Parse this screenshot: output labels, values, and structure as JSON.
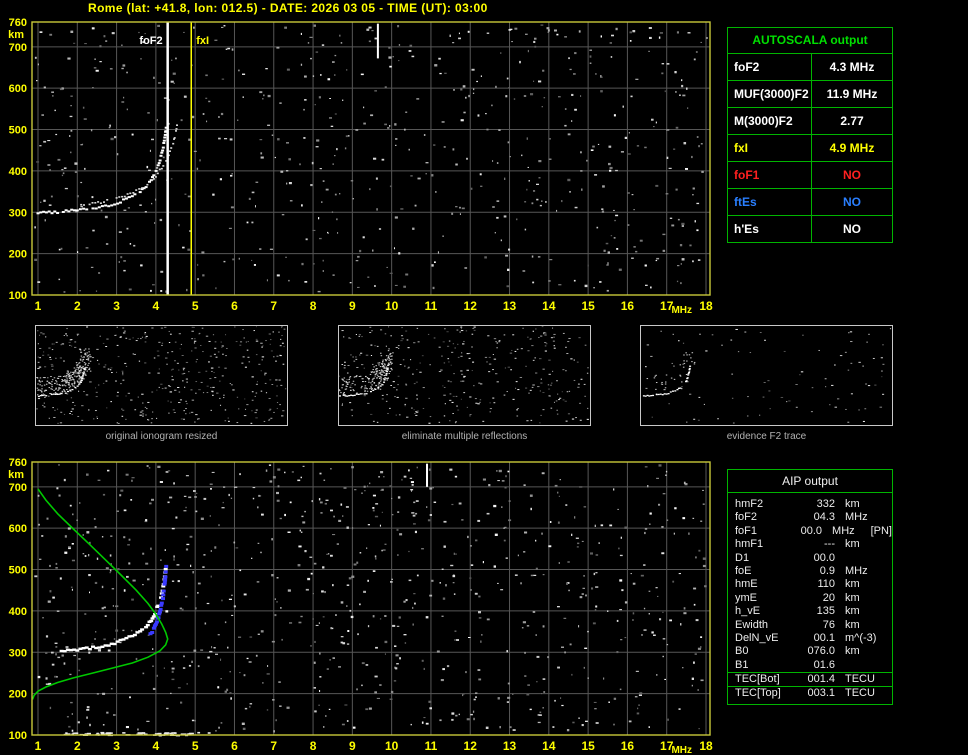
{
  "title": "Rome (lat: +41.8, lon: 012.5) - DATE: 2026 03 05 - TIME (UT): 03:00",
  "axes": {
    "f_min": 1,
    "f_max": 18,
    "km_min": 100,
    "km_max": 760,
    "x_ticks": [
      1,
      2,
      3,
      4,
      5,
      6,
      7,
      8,
      9,
      10,
      11,
      12,
      13,
      14,
      15,
      16,
      17,
      18
    ],
    "y_ticks": [
      760,
      700,
      600,
      500,
      400,
      300,
      200,
      100
    ],
    "x_unit": "MHz",
    "y_unit": "km"
  },
  "main_plot": {
    "noise_seed": 20260305,
    "noise_points": 640,
    "streaks": [
      {
        "f": 9.65,
        "km_top": 756,
        "km_bot": 672
      }
    ],
    "vlines": [
      {
        "label": "foF2",
        "f": 4.3,
        "color": "#ffffff",
        "label_side": "left",
        "width": 2.5
      },
      {
        "label": "fxI",
        "f": 4.9,
        "color": "#ffff00",
        "label_side": "right",
        "width": 1.5
      }
    ],
    "traces": [
      {
        "name": "F2-ordinary-trace",
        "color": "#ffffff",
        "dot": [
          3,
          2
        ],
        "points": [
          [
            1.0,
            298
          ],
          [
            1.5,
            301
          ],
          [
            2.0,
            305
          ],
          [
            2.4,
            310
          ],
          [
            2.8,
            317
          ],
          [
            3.1,
            326
          ],
          [
            3.4,
            338
          ],
          [
            3.6,
            350
          ],
          [
            3.75,
            362
          ],
          [
            3.88,
            377
          ],
          [
            3.98,
            394
          ],
          [
            4.06,
            413
          ],
          [
            4.13,
            434
          ],
          [
            4.19,
            458
          ],
          [
            4.24,
            485
          ],
          [
            4.27,
            512
          ]
        ]
      },
      {
        "name": "F2-extraordinary-trace",
        "color": "#d8d8d8",
        "dot": [
          2,
          1.6
        ],
        "points": [
          [
            2.1,
            316
          ],
          [
            2.6,
            324
          ],
          [
            3.0,
            334
          ],
          [
            3.35,
            345
          ],
          [
            3.65,
            358
          ],
          [
            3.85,
            372
          ],
          [
            4.0,
            388
          ],
          [
            4.15,
            408
          ],
          [
            4.3,
            432
          ],
          [
            4.42,
            460
          ],
          [
            4.5,
            490
          ],
          [
            4.55,
            515
          ]
        ]
      }
    ]
  },
  "thumbnails": [
    {
      "caption": "original ionogram resized",
      "seed": 11,
      "noise": 430,
      "cluster": 240,
      "show_trace": true
    },
    {
      "caption": "eliminate multiple reflections",
      "seed": 22,
      "noise": 360,
      "cluster": 200,
      "show_trace": true
    },
    {
      "caption": "evidence F2 trace",
      "seed": 33,
      "noise": 95,
      "cluster": 35,
      "show_trace": true
    }
  ],
  "bottom_plot": {
    "noise_seed": 7350,
    "noise_points": 820,
    "hclusters": [
      {
        "f1": 1.6,
        "f2": 5.4,
        "km": 104,
        "n": 55
      }
    ],
    "streaks": [
      {
        "f": 10.9,
        "km_top": 756,
        "km_bot": 700
      }
    ],
    "traces": [
      {
        "name": "scaled-F2-trace",
        "color": "#ffffff",
        "dot": [
          4,
          2.4
        ],
        "points": [
          [
            1.6,
            302
          ],
          [
            2.0,
            306
          ],
          [
            2.4,
            311
          ],
          [
            2.8,
            318
          ],
          [
            3.1,
            327
          ],
          [
            3.4,
            339
          ],
          [
            3.6,
            351
          ],
          [
            3.75,
            363
          ],
          [
            3.88,
            378
          ],
          [
            3.98,
            395
          ],
          [
            4.06,
            414
          ],
          [
            4.13,
            435
          ],
          [
            4.19,
            459
          ],
          [
            4.23,
            485
          ],
          [
            4.26,
            508
          ]
        ]
      },
      {
        "name": "fitted-trace",
        "color": "#3a3aff",
        "dot": [
          4,
          3
        ],
        "points": [
          [
            3.82,
            336
          ],
          [
            3.95,
            356
          ],
          [
            4.05,
            380
          ],
          [
            4.12,
            405
          ],
          [
            4.18,
            432
          ],
          [
            4.22,
            462
          ],
          [
            4.25,
            492
          ],
          [
            4.27,
            512
          ]
        ]
      }
    ],
    "lines": [
      {
        "name": "electron-density-profile",
        "color": "#00c800",
        "points": [
          [
            1.0,
            695
          ],
          [
            1.2,
            668
          ],
          [
            1.5,
            635
          ],
          [
            1.9,
            598
          ],
          [
            2.3,
            562
          ],
          [
            2.7,
            525
          ],
          [
            3.1,
            488
          ],
          [
            3.5,
            450
          ],
          [
            3.8,
            418
          ],
          [
            4.0,
            392
          ],
          [
            4.15,
            368
          ],
          [
            4.25,
            348
          ],
          [
            4.3,
            332
          ],
          [
            4.25,
            318
          ],
          [
            4.1,
            303
          ],
          [
            3.8,
            288
          ],
          [
            3.4,
            274
          ],
          [
            2.9,
            262
          ],
          [
            2.4,
            250
          ],
          [
            1.9,
            238
          ],
          [
            1.5,
            227
          ],
          [
            1.2,
            216
          ],
          [
            1.0,
            206
          ],
          [
            0.9,
            196
          ],
          [
            0.86,
            186
          ]
        ]
      }
    ]
  },
  "autoscala_table": {
    "title": "AUTOSCALA output",
    "rows": [
      {
        "label": "foF2",
        "value": "4.3 MHz",
        "color": "#ffffff"
      },
      {
        "label": "MUF(3000)F2",
        "value": "11.9 MHz",
        "color": "#ffffff"
      },
      {
        "label": "M(3000)F2",
        "value": "2.77",
        "color": "#ffffff"
      },
      {
        "label": "fxI",
        "value": "4.9 MHz",
        "color": "#ffff00"
      },
      {
        "label": "foF1",
        "value": "NO",
        "color": "#ff2020"
      },
      {
        "label": "ftEs",
        "value": "NO",
        "color": "#2a7fff"
      },
      {
        "label": "h'Es",
        "value": "NO",
        "color": "#ffffff"
      }
    ]
  },
  "aip_table": {
    "title": "AIP output",
    "rows": [
      {
        "name": "hmF2",
        "value": "332",
        "unit": "km",
        "note": "",
        "sep": false
      },
      {
        "name": "foF2",
        "value": "04.3",
        "unit": "MHz",
        "note": "",
        "sep": false
      },
      {
        "name": "foF1",
        "value": "00.0",
        "unit": "MHz",
        "note": "[PN]",
        "sep": false
      },
      {
        "name": "hmF1",
        "value": "---",
        "unit": "km",
        "note": "",
        "sep": false
      },
      {
        "name": "D1",
        "value": "00.0",
        "unit": "",
        "note": "",
        "sep": false
      },
      {
        "name": "foE",
        "value": "0.9",
        "unit": "MHz",
        "note": "",
        "sep": false
      },
      {
        "name": "hmE",
        "value": "110",
        "unit": "km",
        "note": "",
        "sep": false
      },
      {
        "name": "ymE",
        "value": "20",
        "unit": "km",
        "note": "",
        "sep": false
      },
      {
        "name": "h_vE",
        "value": "135",
        "unit": "km",
        "note": "",
        "sep": false
      },
      {
        "name": "Ewidth",
        "value": "76",
        "unit": "km",
        "note": "",
        "sep": false
      },
      {
        "name": "DelN_vE",
        "value": "00.1",
        "unit": "m^(-3)",
        "note": "",
        "sep": false
      },
      {
        "name": "B0",
        "value": "076.0",
        "unit": "km",
        "note": "",
        "sep": false
      },
      {
        "name": "B1",
        "value": "01.6",
        "unit": "",
        "note": "",
        "sep": false
      },
      {
        "name": "TEC[Bot]",
        "value": "001.4",
        "unit": "TECU",
        "note": "",
        "sep": true
      },
      {
        "name": "TEC[Top]",
        "value": "003.1",
        "unit": "TECU",
        "note": "",
        "sep": true
      }
    ]
  }
}
